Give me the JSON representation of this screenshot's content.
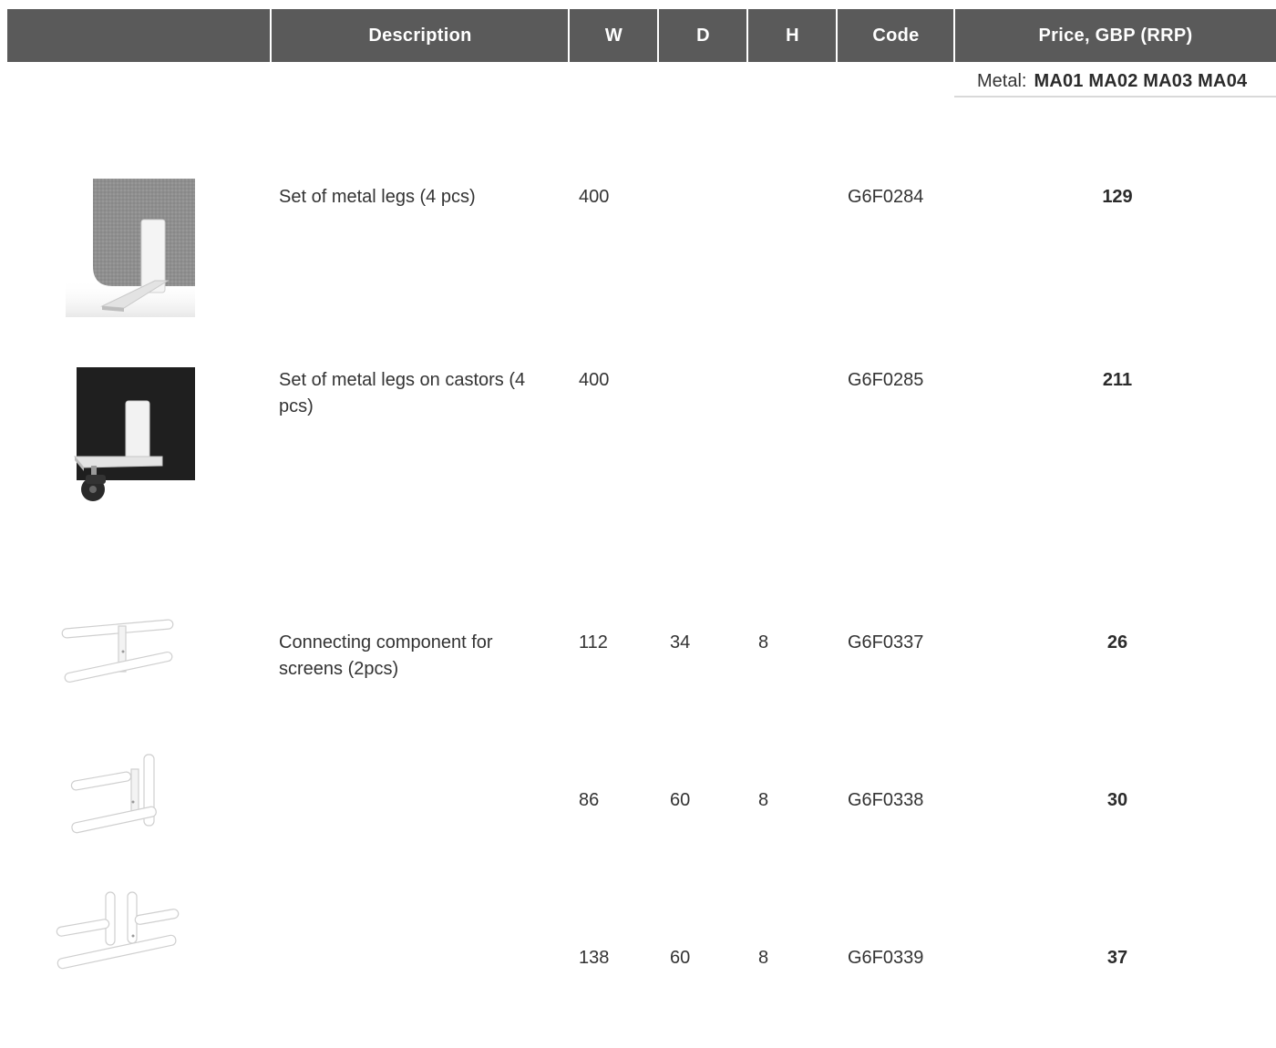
{
  "header": {
    "col0": "",
    "description": "Description",
    "w": "W",
    "d": "D",
    "h": "H",
    "code": "Code",
    "price": "Price, GBP (RRP)"
  },
  "metal": {
    "label": "Metal:",
    "codes": "MA01 MA02 MA03 MA04"
  },
  "rows": [
    {
      "image": "grey-screen-metal-leg",
      "description": "Set of metal legs (4 pcs)",
      "w": "400",
      "d": "",
      "h": "",
      "code": "G6F0284",
      "price": "129"
    },
    {
      "image": "black-screen-leg-castor",
      "description": "Set of metal legs on castors (4 pcs)",
      "w": "400",
      "d": "",
      "h": "",
      "code": "G6F0285",
      "price": "211"
    },
    {
      "image": "h-connector",
      "description": "Connecting component  for screens (2pcs)",
      "w": "112",
      "d": "34",
      "h": "8",
      "code": "G6F0337",
      "price": "26"
    },
    {
      "image": "l-connector",
      "description": "",
      "w": "86",
      "d": "60",
      "h": "8",
      "code": "G6F0338",
      "price": "30"
    },
    {
      "image": "t-connector",
      "description": "",
      "w": "138",
      "d": "60",
      "h": "8",
      "code": "G6F0339",
      "price": "37"
    }
  ]
}
